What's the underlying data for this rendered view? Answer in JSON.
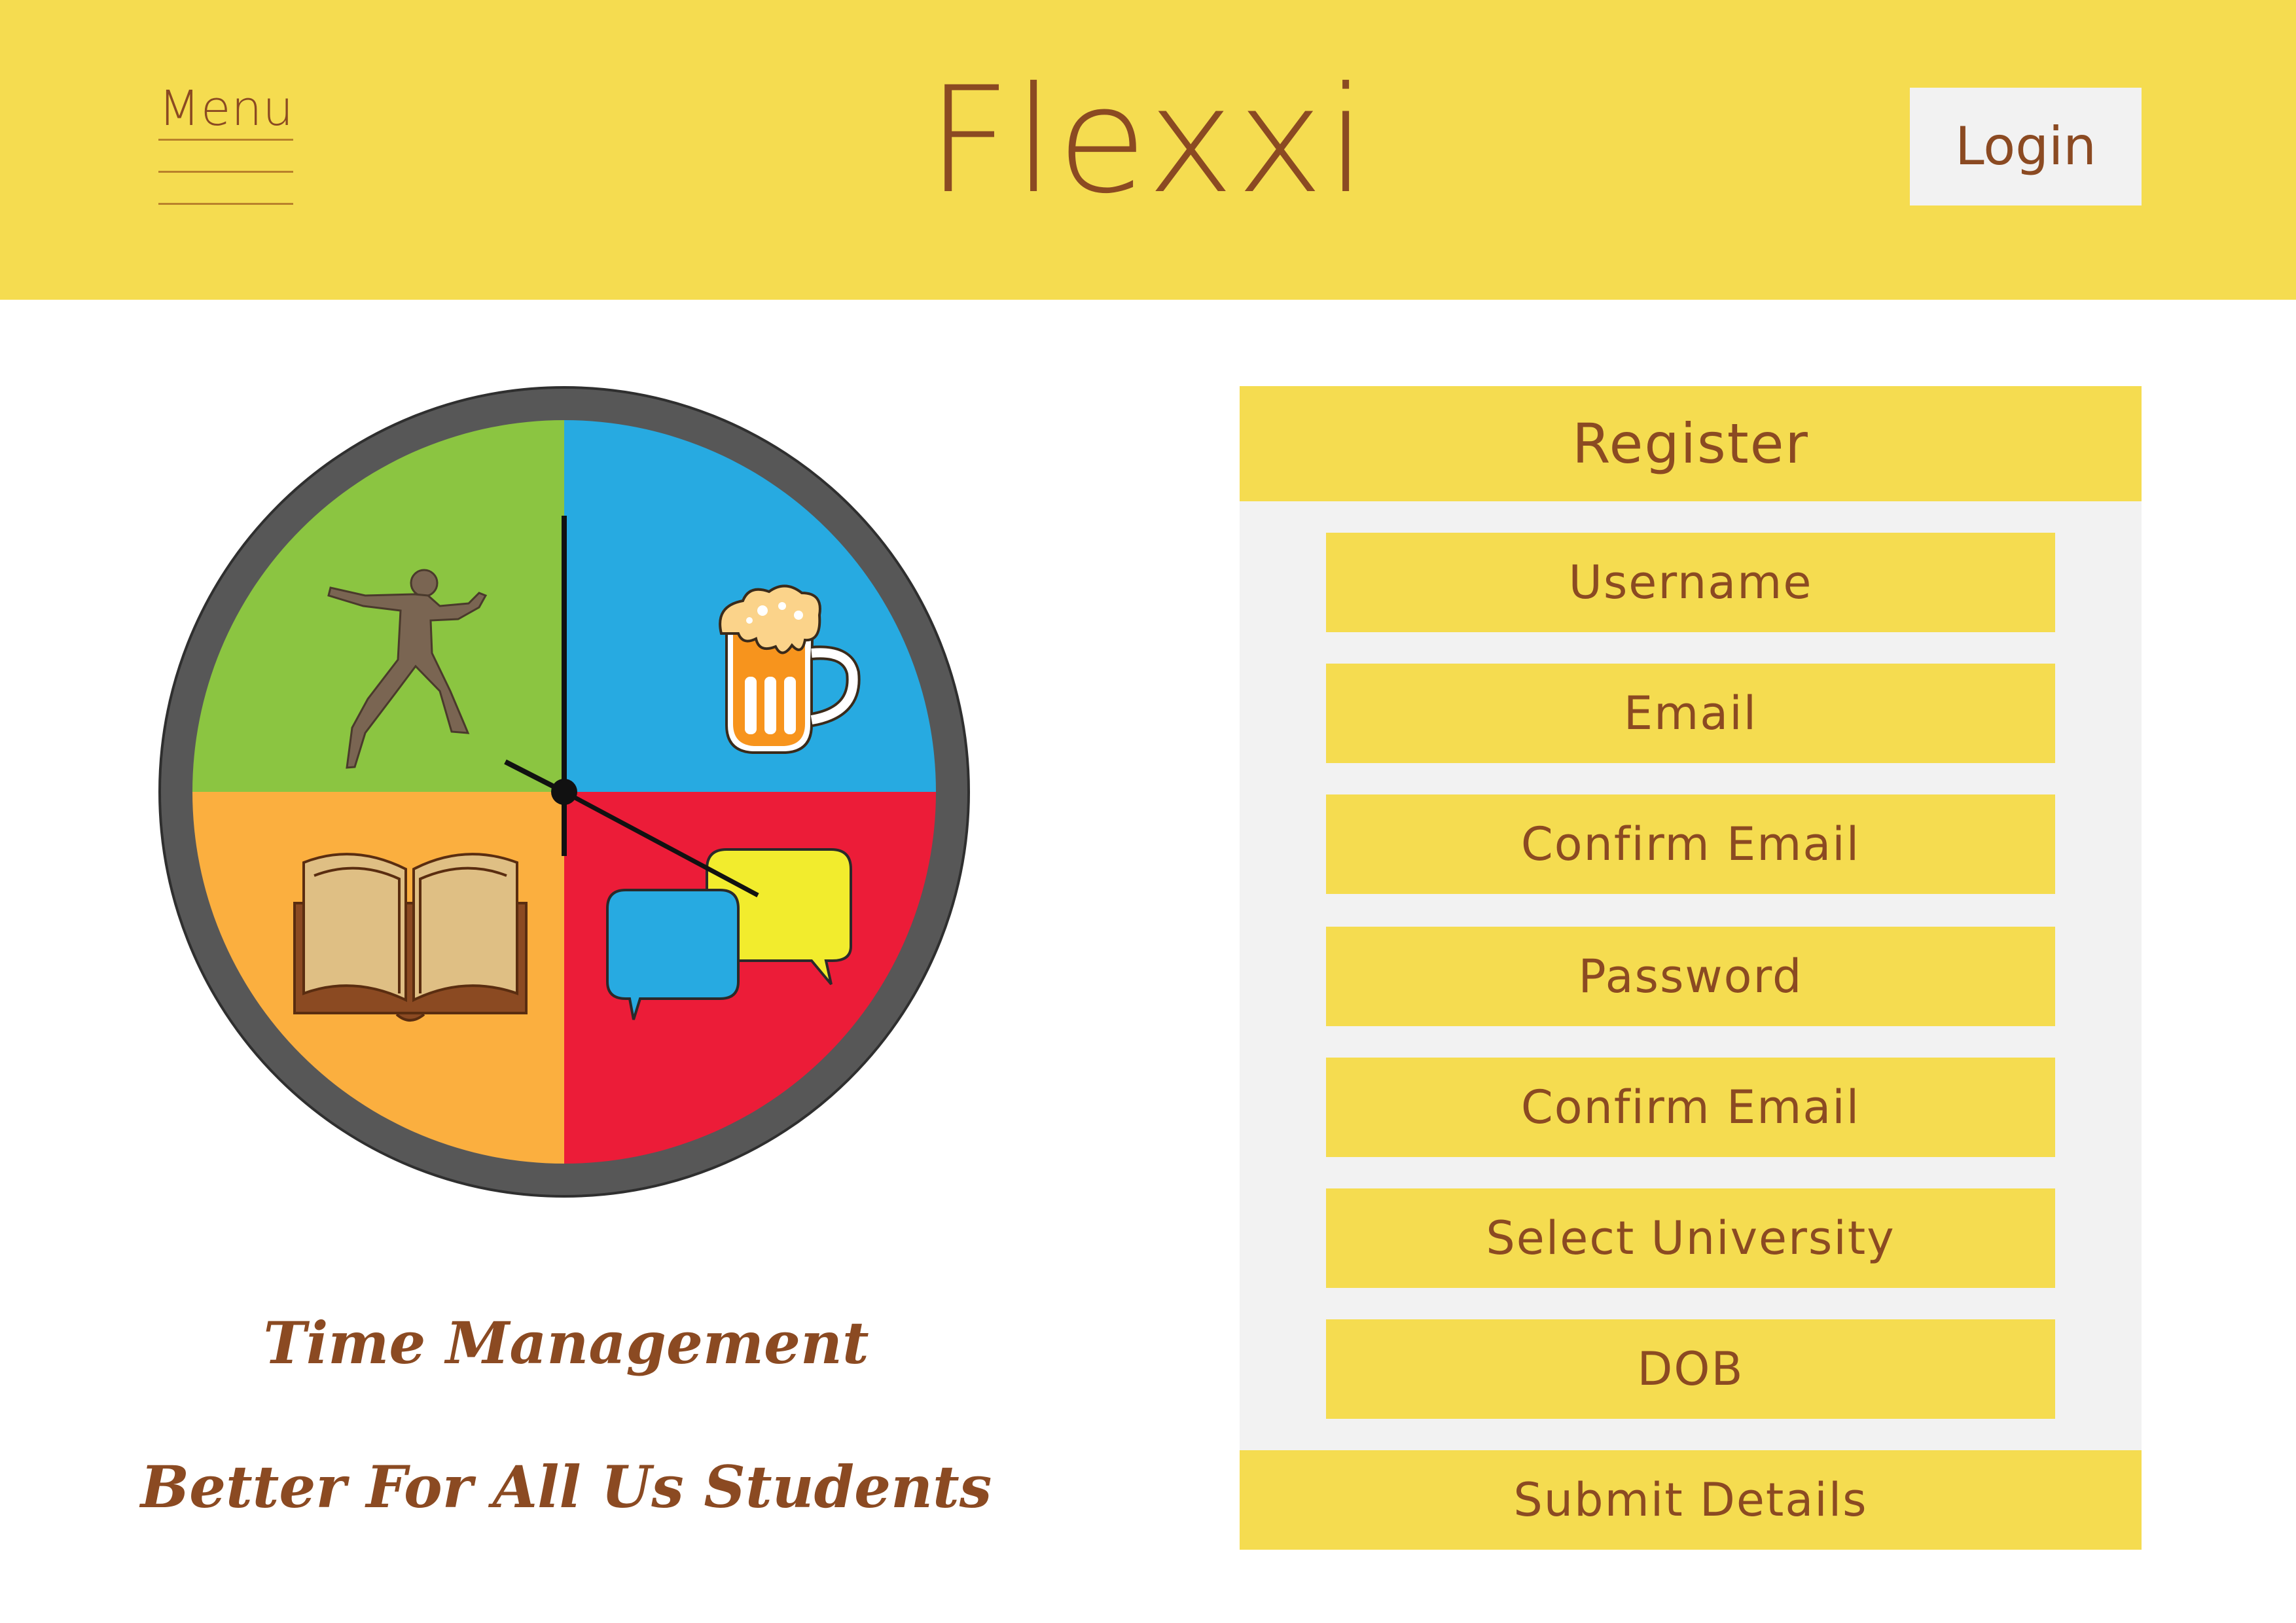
{
  "header": {
    "menu_label": "Menu",
    "brand": "Flexxi",
    "login_label": "Login"
  },
  "clock": {
    "quadrants": [
      {
        "name": "sport",
        "icon": "runner-icon",
        "color": "#8bc541"
      },
      {
        "name": "social-drink",
        "icon": "beer-mug-icon",
        "color": "#27aae1"
      },
      {
        "name": "study",
        "icon": "open-book-icon",
        "color": "#fbaf3f"
      },
      {
        "name": "chat",
        "icon": "chat-bubbles-icon",
        "color": "#ec1c38"
      }
    ],
    "rim_color": "#575757"
  },
  "taglines": {
    "line1": "Time Management",
    "line2": "Better For All Us Students"
  },
  "register": {
    "title": "Register",
    "fields": {
      "username": "Username",
      "email": "Email",
      "confirm_email": "Confirm Email",
      "password": "Password",
      "confirm_email_2": "Confirm Email",
      "university": "Select University",
      "dob": "DOB"
    },
    "submit_label": "Submit Details"
  },
  "colors": {
    "accent_yellow": "#f5dc50",
    "text_brown": "#8b4a22",
    "panel_grey": "#f2f2f2"
  }
}
